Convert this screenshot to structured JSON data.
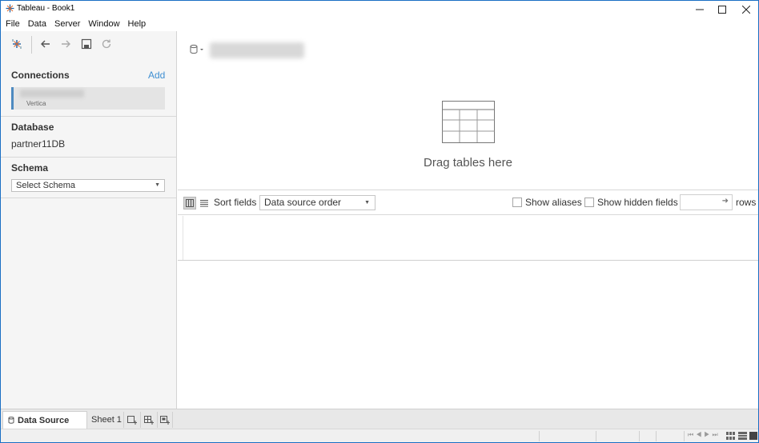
{
  "window": {
    "title": "Tableau - Book1",
    "minimize_icon": "minimize-icon",
    "maximize_icon": "maximize-icon",
    "close_icon": "close-icon"
  },
  "menu": [
    "File",
    "Data",
    "Server",
    "Window",
    "Help"
  ],
  "sidebar": {
    "toolbar": [
      "tableau-logo-icon",
      "back-arrow-icon",
      "forward-arrow-icon",
      "save-icon",
      "refresh-icon"
    ],
    "connections_title": "Connections",
    "add_label": "Add",
    "connection_type": "Vertica",
    "database_title": "Database",
    "database_name": "partner11DB",
    "schema_title": "Schema",
    "schema_placeholder": "Select Schema"
  },
  "canvas": {
    "drag_text": "Drag tables here"
  },
  "grid_toolbar": {
    "sort_fields_label": "Sort fields",
    "sort_value": "Data source order",
    "show_aliases_label": "Show aliases",
    "show_hidden_label": "Show hidden fields",
    "rows_label": "rows"
  },
  "tabs": {
    "data_source_label": "Data Source",
    "sheet_label": "Sheet 1"
  },
  "colors": {
    "accent": "#3f8fd2",
    "window_border": "#1a6fc4"
  }
}
